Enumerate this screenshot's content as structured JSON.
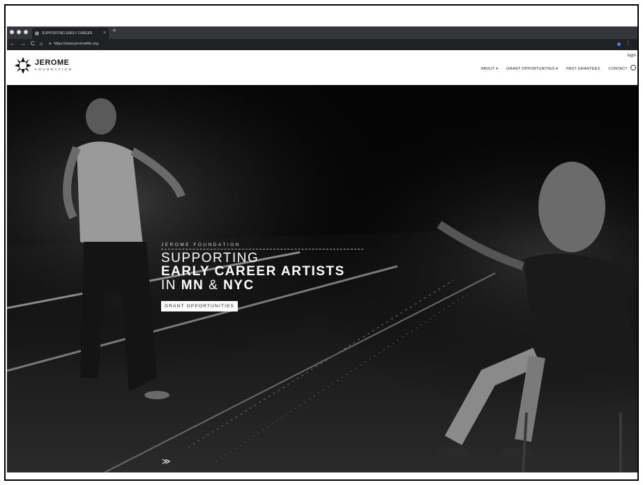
{
  "browser": {
    "tab_title": "SUPPORTING EARLY CAREER",
    "tab_close": "×",
    "new_tab": "+",
    "back": "←",
    "forward": "→",
    "reload": "C",
    "home": "⌂",
    "url": "https://www.jeromefdn.org"
  },
  "site": {
    "logo_line1": "JEROME",
    "logo_line2": "FOUNDATION",
    "login": "login",
    "nav": {
      "about": "ABOUT ▾",
      "grant_opportunities": "GRANT OPPORTUNITIES ▾",
      "past_grantees": "PAST GRANTEES",
      "contact": "CONTACT"
    }
  },
  "hero": {
    "eyebrow": "JEROME FOUNDATION",
    "line1": "SUPPORTING",
    "line2": "EARLY CAREER ARTISTS",
    "line3_prefix": "IN ",
    "line3_mn": "MN",
    "line3_mid": " & ",
    "line3_nyc": "NYC",
    "cta": "GRANT OPPORTUNITIES",
    "scroll_glyph": "≫"
  },
  "colors": {
    "chrome_dark": "#35363a",
    "chrome_darker": "#202124",
    "hero_bg": "#050505"
  }
}
